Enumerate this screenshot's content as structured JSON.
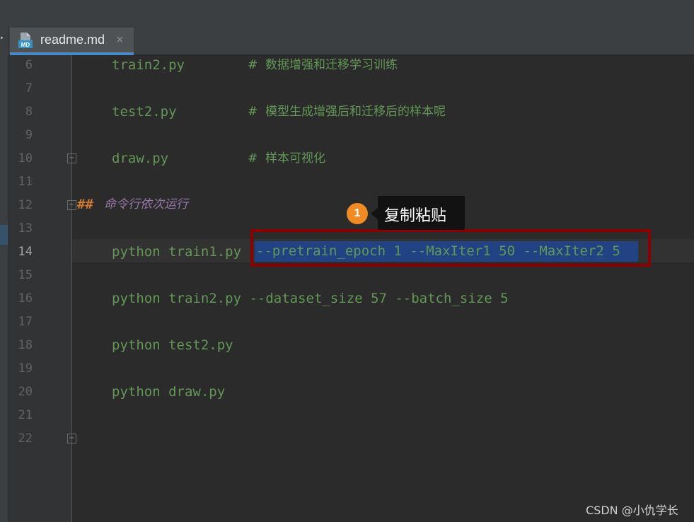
{
  "tab": {
    "file_name": "readme.md",
    "close_glyph": "×",
    "icon": "markdown-file-icon",
    "icon_text": "MD"
  },
  "editor": {
    "line_numbers": [
      "6",
      "7",
      "8",
      "9",
      "10",
      "11",
      "12",
      "13",
      "14",
      "15",
      "16",
      "17",
      "18",
      "19",
      "20",
      "21",
      "22"
    ],
    "active_line": "14",
    "lines": {
      "l6_code": "train2.py",
      "l6_comment": "#  数据增强和迁移学习训练",
      "l8_code": "test2.py",
      "l8_comment": "#  模型生成增强后和迁移后的样本呢",
      "l10_code": "draw.py",
      "l10_comment": "#  样本可视化",
      "l12_hash": "##",
      "l12_text": "命令行依次运行",
      "l14_prefix": "python train1.py",
      "l14_selected": "--pretrain_epoch 1 --MaxIter1 50 --MaxIter2 5",
      "l16_code": "python train2.py --dataset_size 57 --batch_size 5",
      "l18_code": "python test2.py",
      "l20_code": "python draw.py"
    }
  },
  "annotation": {
    "badge": "1",
    "tooltip": "复制粘贴"
  },
  "watermark": "CSDN @小仇学长",
  "colors": {
    "background": "#2b2b2b",
    "code_green": "#629755",
    "selection": "#214283",
    "highlight_box": "#8b0000",
    "badge": "#f08a24",
    "tab_accent": "#4a88c7"
  }
}
